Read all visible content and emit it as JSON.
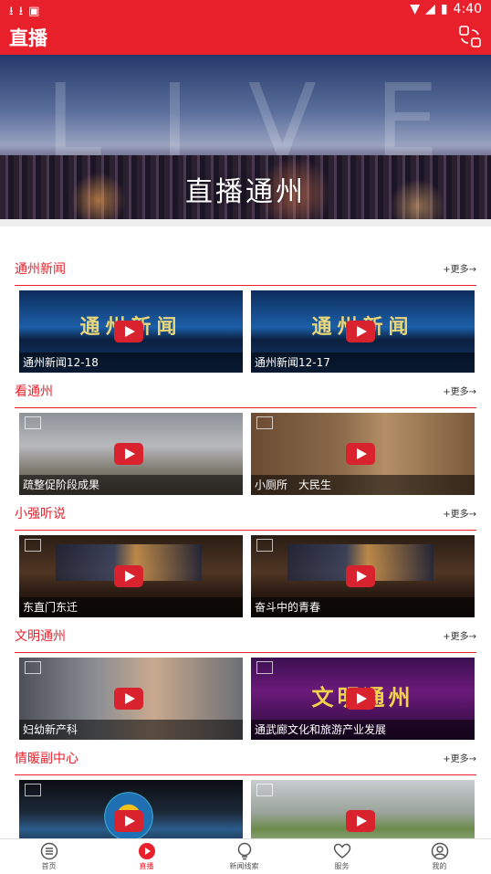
{
  "status_bar": {
    "time": "4:40"
  },
  "header": {
    "title": "直播"
  },
  "banner": {
    "watermark": "LIVE",
    "text": "直播通州"
  },
  "sections": [
    {
      "title": "通州新闻",
      "more": "+更多→",
      "items": [
        {
          "caption": "通州新闻12-18",
          "overlay": "通州新闻"
        },
        {
          "caption": "通州新闻12-17",
          "overlay": "通州新闻"
        }
      ]
    },
    {
      "title": "看通州",
      "more": "+更多→",
      "items": [
        {
          "caption": "疏整促阶段成果"
        },
        {
          "caption": "小厕所　大民生"
        }
      ]
    },
    {
      "title": "小强听说",
      "more": "+更多→",
      "items": [
        {
          "caption": "东直门东迁"
        },
        {
          "caption": "奋斗中的青春"
        }
      ]
    },
    {
      "title": "文明通州",
      "more": "+更多→",
      "items": [
        {
          "caption": "妇幼新产科"
        },
        {
          "caption": "通武廊文化和旅游产业发展",
          "overlay": "文明通州"
        }
      ]
    },
    {
      "title": "情暖副中心",
      "more": "+更多→",
      "items": [
        {
          "caption": ""
        },
        {
          "caption": ""
        }
      ]
    }
  ],
  "tabbar": [
    {
      "label": "首页",
      "icon": "home-list-icon",
      "active": false
    },
    {
      "label": "直播",
      "icon": "play-circle-icon",
      "active": true
    },
    {
      "label": "新闻线索",
      "icon": "bulb-icon",
      "active": false
    },
    {
      "label": "服务",
      "icon": "heart-icon",
      "active": false
    },
    {
      "label": "我的",
      "icon": "user-icon",
      "active": false
    }
  ],
  "colors": {
    "brand": "#e8202c",
    "divider": "#e8202c"
  }
}
